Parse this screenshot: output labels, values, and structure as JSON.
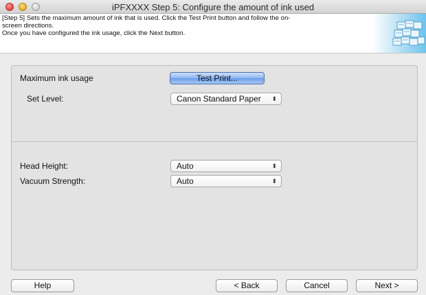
{
  "window": {
    "title": "iPFXXXX Step 5: Configure the amount of ink used"
  },
  "header": {
    "line1": "[Step 5] Sets the maximum amount of ink that is used. Click the Test Print button and follow the on-",
    "line2": "screen directions.",
    "line3": "Once you have configured the ink usage, click the Next button.",
    "graphic_icon": "printer-stack-graphic"
  },
  "ink_section": {
    "label": "Maximum ink usage",
    "test_print_label": "Test Print...",
    "set_level_label": "Set Level:",
    "set_level_value": "Canon Standard Paper"
  },
  "head_section": {
    "head_height_label": "Head Height:",
    "head_height_value": "Auto",
    "vacuum_label": "Vacuum Strength:",
    "vacuum_value": "Auto"
  },
  "select_arrows": "⬍",
  "footer": {
    "help_label": "Help",
    "back_label": "< Back",
    "cancel_label": "Cancel",
    "next_label": "Next >"
  },
  "colors": {
    "primary_button": "#7aa8ec",
    "panel_bg": "#e3e3e3",
    "header_bg": "#ffffff"
  }
}
